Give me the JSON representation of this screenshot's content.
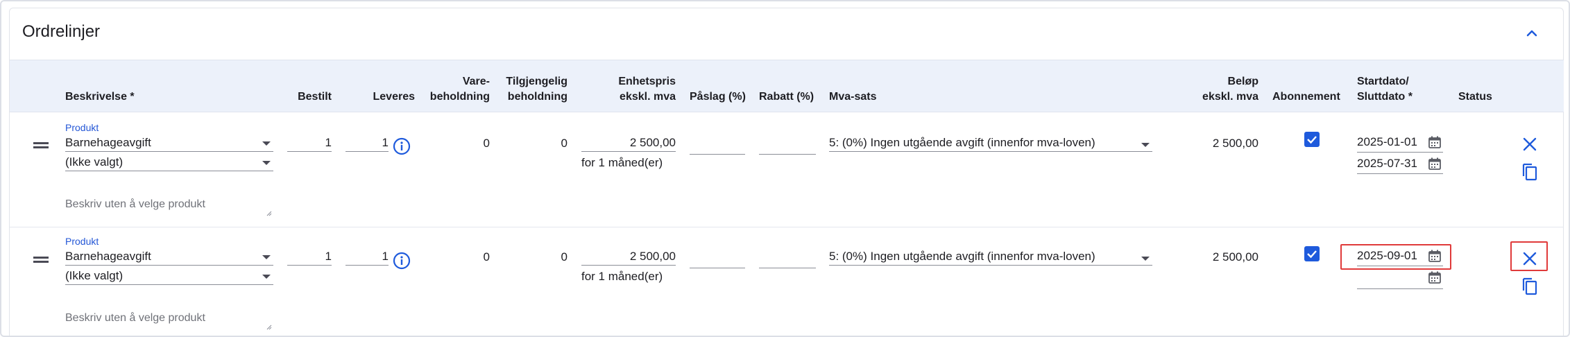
{
  "section": {
    "title": "Ordrelinjer"
  },
  "columns": {
    "beskrivelse": "Beskrivelse *",
    "bestilt": "Bestilt",
    "leveres": "Leveres",
    "vare_1": "Vare-",
    "vare_2": "beholdning",
    "tilgj_1": "Tilgjengelig",
    "tilgj_2": "beholdning",
    "enhet_1": "Enhetspris",
    "enhet_2": "ekskl. mva",
    "paslag": "Påslag (%)",
    "rabatt": "Rabatt (%)",
    "mva": "Mva-sats",
    "belop_1": "Beløp",
    "belop_2": "ekskl. mva",
    "abonnement": "Abonnement",
    "dato_1": "Startdato/",
    "dato_2": "Sluttdato *",
    "status": "Status"
  },
  "rows": [
    {
      "product_label": "Produkt",
      "product": "Barnehageavgift",
      "variant": "(Ikke valgt)",
      "description_placeholder": "Beskriv uten å velge produkt",
      "bestilt": "1",
      "leveres": "1",
      "varebeholdning": "0",
      "tilgjengelig": "0",
      "enhetspris": "2 500,00",
      "period": "for 1 måned(er)",
      "paslag": "",
      "rabatt": "",
      "mva": "5: (0%) Ingen utgående avgift (innenfor mva-loven)",
      "belop": "2 500,00",
      "abonnement": true,
      "startdato": "2025-01-01",
      "sluttdato": "2025-07-31"
    },
    {
      "product_label": "Produkt",
      "product": "Barnehageavgift",
      "variant": "(Ikke valgt)",
      "description_placeholder": "Beskriv uten å velge produkt",
      "bestilt": "1",
      "leveres": "1",
      "varebeholdning": "0",
      "tilgjengelig": "0",
      "enhetspris": "2 500,00",
      "period": "for 1 måned(er)",
      "paslag": "",
      "rabatt": "",
      "mva": "5: (0%) Ingen utgående avgift (innenfor mva-loven)",
      "belop": "2 500,00",
      "abonnement": true,
      "startdato": "2025-09-01",
      "sluttdato": ""
    }
  ],
  "icons": {
    "collapse": "chevron-up-icon",
    "drag": "drag-handle-icon",
    "info": "info-icon",
    "calendar": "calendar-icon",
    "delete": "close-icon",
    "copy": "copy-icon",
    "checkbox": "checkbox-checked-icon"
  },
  "colors": {
    "accent": "#1e5adc",
    "header_bg": "#ecf1fa",
    "highlight": "#e03a3a"
  }
}
